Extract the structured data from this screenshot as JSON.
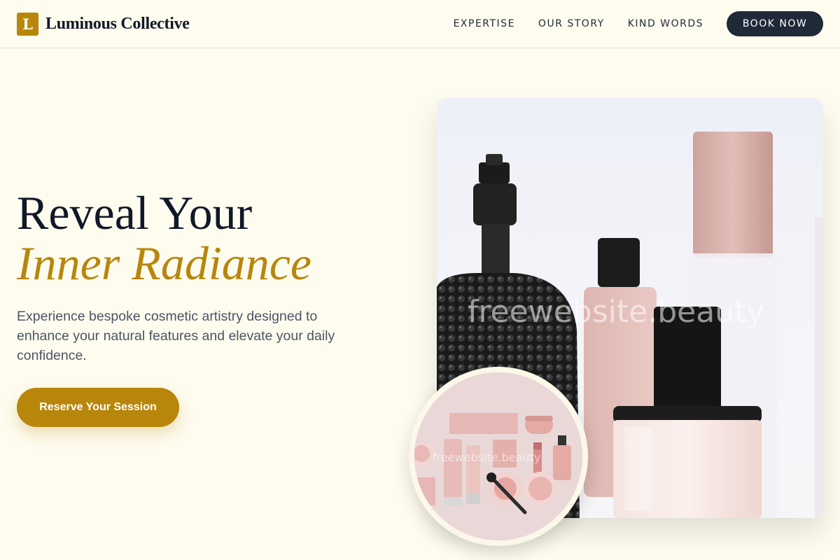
{
  "header": {
    "logo_letter": "L",
    "brand_name": "Luminous Collective",
    "nav": [
      "EXPERTISE",
      "OUR STORY",
      "KIND WORDS"
    ],
    "book_label": "BOOK NOW"
  },
  "hero": {
    "title_line1": "Reveal Your",
    "title_line2": "Inner Radiance",
    "description": "Experience bespoke cosmetic artistry designed to enhance your natural features and elevate your daily confidence.",
    "cta_label": "Reserve Your Session"
  },
  "image": {
    "watermark": "freewebsite.beauty",
    "circle_watermark": "freewebsite.beauty"
  },
  "colors": {
    "accent": "#b8860b",
    "dark": "#1f2937",
    "background": "#fefcef"
  }
}
